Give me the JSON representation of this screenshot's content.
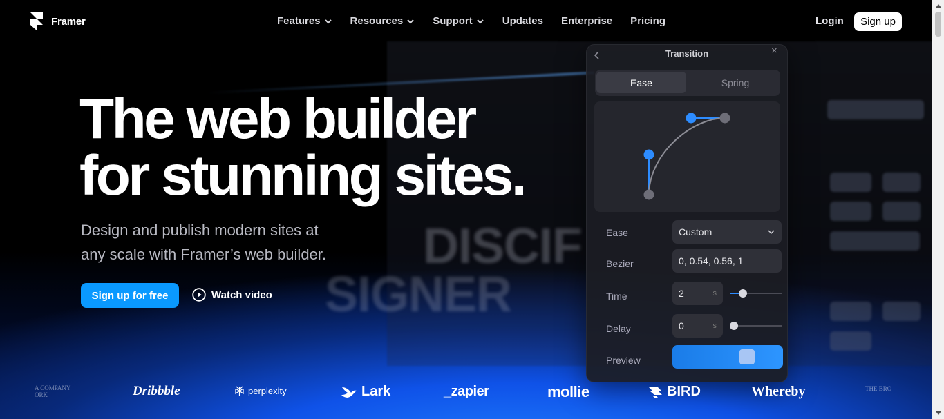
{
  "nav": {
    "brand": "Framer",
    "links": [
      {
        "label": "Features",
        "has_dropdown": true
      },
      {
        "label": "Resources",
        "has_dropdown": true
      },
      {
        "label": "Support",
        "has_dropdown": true
      },
      {
        "label": "Updates",
        "has_dropdown": false
      },
      {
        "label": "Enterprise",
        "has_dropdown": false
      },
      {
        "label": "Pricing",
        "has_dropdown": false
      }
    ],
    "login": "Login",
    "signup": "Sign up"
  },
  "hero": {
    "title_line1": "The web builder",
    "title_line2": "for stunning sites.",
    "subtitle_line1": "Design and publish modern sites at",
    "subtitle_line2": "any scale with Framer’s web builder.",
    "cta_primary": "Sign up for free",
    "cta_video": "Watch video"
  },
  "background": {
    "word1": "DISCIF",
    "word2": "SIGNER"
  },
  "transition_panel": {
    "title": "Transition",
    "tabs": [
      {
        "label": "Ease",
        "active": true
      },
      {
        "label": "Spring",
        "active": false
      }
    ],
    "ease_label": "Ease",
    "ease_value": "Custom",
    "bezier_label": "Bezier",
    "bezier_value": "0, 0.54, 0.56, 1",
    "time_label": "Time",
    "time_value": "2",
    "time_unit": "s",
    "time_level": 0.2,
    "delay_label": "Delay",
    "delay_value": "0",
    "delay_unit": "s",
    "delay_level": 0,
    "preview_label": "Preview",
    "preview_progress": 0.72
  },
  "logos": {
    "left_faded_line1": "A COMPANY",
    "left_faded_line2": "ORK",
    "dribbble": "Dribbble",
    "perplexity": "perplexity",
    "lark": "Lark",
    "zapier": "_zapier",
    "mollie": "mollie",
    "bird": "BIRD",
    "whereby": "Whereby",
    "right_faded": "THE BRO"
  },
  "colors": {
    "accent": "#0a99ff",
    "background": "#000000",
    "curve_point": "#2d8cff",
    "curve_point_end": "#777777"
  }
}
